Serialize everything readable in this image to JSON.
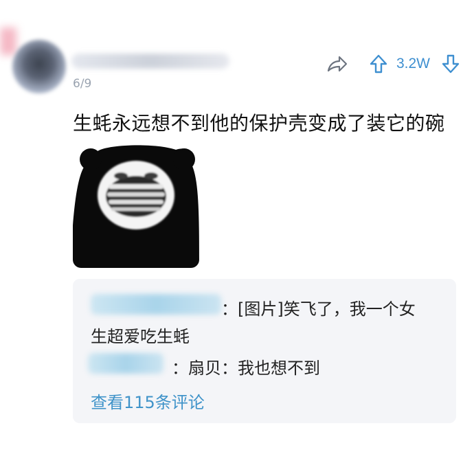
{
  "post": {
    "date": "6/9",
    "vote_count": "3.2W",
    "text": "生蚝永远想不到他的保护壳变成了装它的碗",
    "icons": {
      "share": "share-arrow-icon",
      "upvote": "upvote-arrow-icon",
      "downvote": "downvote-arrow-icon"
    }
  },
  "comments": {
    "items": [
      {
        "separator": "：",
        "text_line1": "[图片]笑飞了，我一个女",
        "text_line2": "生超爱吃生蚝"
      },
      {
        "separator": "：",
        "text": "扇贝：我也想不到"
      }
    ],
    "view_more": "查看115条评论"
  },
  "colors": {
    "accent": "#3e8fd0",
    "link": "#3f93c9",
    "date": "#9aa3b0",
    "comment_bg": "#f4f5f8"
  }
}
